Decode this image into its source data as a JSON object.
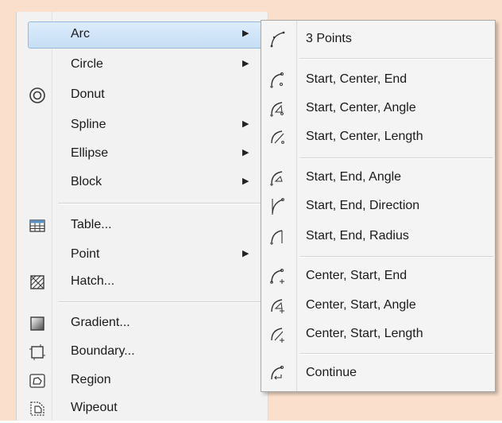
{
  "main_menu": {
    "items": [
      {
        "label": "Arc",
        "icon": "",
        "has_submenu": true,
        "highlighted": true
      },
      {
        "label": "Circle",
        "icon": "",
        "has_submenu": true
      },
      {
        "label": "Donut",
        "icon": "donut-icon",
        "has_submenu": false
      },
      {
        "label": "Spline",
        "icon": "",
        "has_submenu": true
      },
      {
        "label": "Ellipse",
        "icon": "",
        "has_submenu": true
      },
      {
        "label": "Block",
        "icon": "",
        "has_submenu": true
      },
      {
        "label": "Table...",
        "icon": "table-icon",
        "has_submenu": false
      },
      {
        "label": "Point",
        "icon": "",
        "has_submenu": true
      },
      {
        "label": "Hatch...",
        "icon": "hatch-icon",
        "has_submenu": false
      },
      {
        "label": "Gradient...",
        "icon": "gradient-icon",
        "has_submenu": false
      },
      {
        "label": "Boundary...",
        "icon": "boundary-icon",
        "has_submenu": false
      },
      {
        "label": "Region",
        "icon": "region-icon",
        "has_submenu": false
      },
      {
        "label": "Wipeout",
        "icon": "wipeout-icon",
        "has_submenu": false
      }
    ],
    "submenu_arrow": "▶"
  },
  "arc_submenu": {
    "items": [
      {
        "label": "3 Points",
        "icon": "arc-3-points-icon"
      },
      {
        "label": "Start, Center, End",
        "icon": "arc-start-center-end-icon"
      },
      {
        "label": "Start, Center, Angle",
        "icon": "arc-start-center-angle-icon"
      },
      {
        "label": "Start, Center, Length",
        "icon": "arc-start-center-length-icon"
      },
      {
        "label": "Start, End, Angle",
        "icon": "arc-start-end-angle-icon"
      },
      {
        "label": "Start, End, Direction",
        "icon": "arc-start-end-direction-icon"
      },
      {
        "label": "Start, End, Radius",
        "icon": "arc-start-end-radius-icon"
      },
      {
        "label": "Center, Start, End",
        "icon": "arc-center-start-end-icon"
      },
      {
        "label": "Center, Start, Angle",
        "icon": "arc-center-start-angle-icon"
      },
      {
        "label": "Center, Start, Length",
        "icon": "arc-center-start-length-icon"
      },
      {
        "label": "Continue",
        "icon": "arc-continue-icon"
      }
    ]
  },
  "colors": {
    "backdrop": "#fae0cc",
    "menu_bg": "#f2f2f2",
    "highlight": "#c7def5"
  }
}
